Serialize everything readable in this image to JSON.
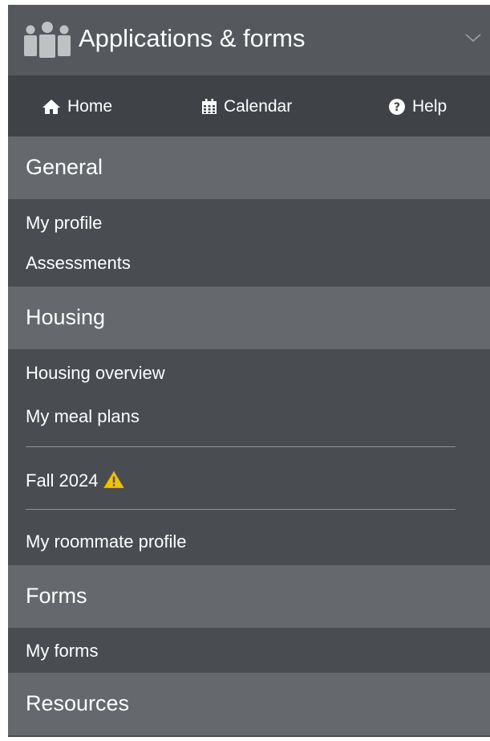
{
  "header": {
    "title": "Applications & forms",
    "icon": "people-group-icon",
    "toggle_icon": "chevron-down-icon"
  },
  "quick_nav": [
    {
      "label": "Home",
      "icon": "home-icon"
    },
    {
      "label": "Calendar",
      "icon": "calendar-icon"
    },
    {
      "label": "Help",
      "icon": "question-circle-icon"
    }
  ],
  "sections": {
    "general": {
      "title": "General",
      "items": [
        {
          "label": "My profile"
        },
        {
          "label": "Assessments"
        }
      ]
    },
    "housing": {
      "title": "Housing",
      "items": [
        {
          "label": "Housing overview"
        },
        {
          "label": "My meal plans"
        },
        {
          "label": "Fall 2024",
          "icon": "warning-icon"
        },
        {
          "label": "My roommate profile"
        }
      ]
    },
    "forms": {
      "title": "Forms",
      "items": [
        {
          "label": "My forms"
        }
      ]
    },
    "resources": {
      "title": "Resources"
    }
  },
  "colors": {
    "panel_background": "#494d52",
    "header_background": "#55595e",
    "quicknav_background": "#3f4348",
    "section_header_background": "#65696d",
    "text": "#ffffff",
    "warning": "#f2c200"
  }
}
